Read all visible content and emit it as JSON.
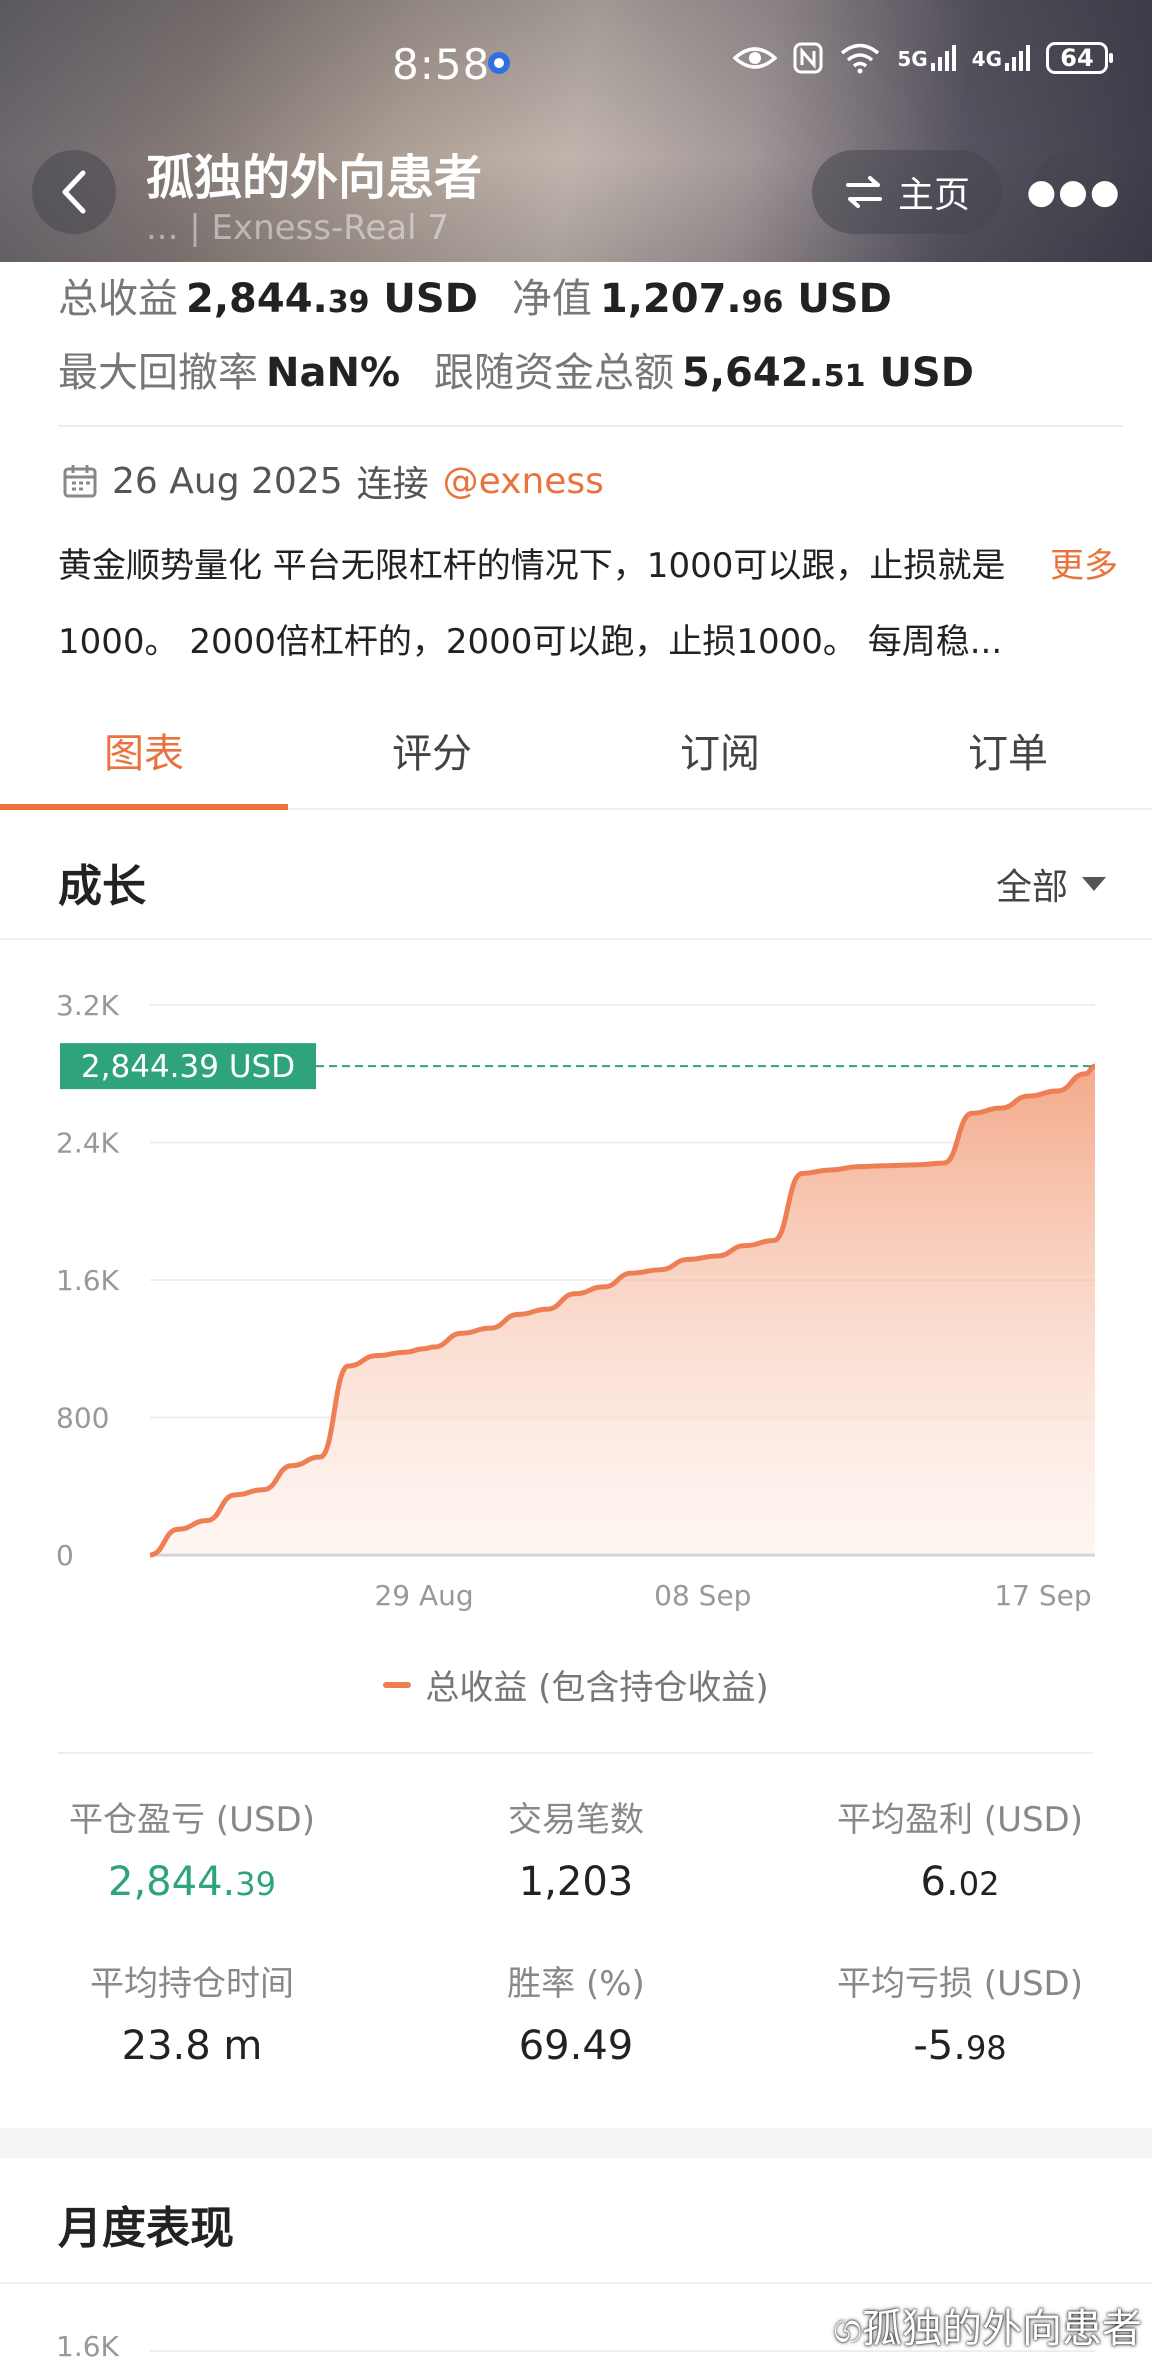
{
  "status_bar": {
    "time": "8:58",
    "network_1": "5G",
    "network_2": "4G",
    "battery": "64"
  },
  "header": {
    "title": "孤独的外向患者",
    "subtitle": "... | Exness-Real 7",
    "home_label": "主页"
  },
  "summary": {
    "total_profit_label": "总收益",
    "total_profit_int": "2,844.",
    "total_profit_dec": "39",
    "total_profit_unit": "USD",
    "equity_label": "净值",
    "equity_int": "1,207.",
    "equity_dec": "96",
    "equity_unit": "USD",
    "max_drawdown_label": "最大回撤率",
    "max_drawdown_value": "NaN%",
    "follow_funds_label": "跟随资金总额",
    "follow_funds_int": "5,642.",
    "follow_funds_dec": "51",
    "follow_funds_unit": "USD"
  },
  "meta": {
    "date": "26 Aug 2025",
    "connect_label": "连接",
    "broker_handle": "@exness"
  },
  "description": {
    "text": "黄金顺势量化 平台无限杠杆的情况下，1000可以跟，止损就是1000。 2000倍杠杆的，2000可以跑，止损1000。 每周稳...",
    "more_label": "更多"
  },
  "tabs": [
    {
      "label": "图表"
    },
    {
      "label": "评分"
    },
    {
      "label": "订阅"
    },
    {
      "label": "订单"
    }
  ],
  "growth": {
    "title": "成长",
    "range": "全部"
  },
  "chart_data": {
    "type": "area",
    "y_ticks": [
      "3.2K",
      "2.4K",
      "1.6K",
      "800",
      "0"
    ],
    "ylim": [
      0,
      3200
    ],
    "x_ticks": [
      "29 Aug",
      "08 Sep",
      "17 Sep"
    ],
    "current_label": "2,844.39 USD",
    "current_value": 2844.39,
    "legend": "总收益 (包含持仓收益)",
    "line_color": "#ee7f55",
    "marker_color": "#2fa37e",
    "x_index": [
      0,
      3,
      6,
      9,
      12,
      15,
      18,
      21,
      24,
      27,
      29,
      30,
      33,
      36,
      39,
      42,
      45,
      48,
      51,
      54,
      57,
      60,
      63,
      66,
      69,
      72,
      75,
      78,
      81,
      84,
      87,
      90,
      93,
      96,
      99,
      100
    ],
    "series": [
      {
        "values": [
          0,
          150,
          200,
          350,
          380,
          520,
          570,
          1100,
          1160,
          1180,
          1200,
          1210,
          1290,
          1320,
          1400,
          1430,
          1520,
          1560,
          1640,
          1660,
          1720,
          1740,
          1800,
          1830,
          2220,
          2240,
          2260,
          2265,
          2270,
          2280,
          2570,
          2600,
          2670,
          2700,
          2800,
          2844.39
        ]
      }
    ]
  },
  "stats": [
    {
      "label": "平仓盈亏 (USD)",
      "int": "2,844.",
      "dec": "39",
      "green": true
    },
    {
      "label": "交易笔数",
      "int": "1,203",
      "dec": "",
      "green": false
    },
    {
      "label": "平均盈利 (USD)",
      "int": "6.",
      "dec": "02",
      "green": false
    },
    {
      "label": "平均持仓时间",
      "int": "23.8 m",
      "dec": "",
      "green": false
    },
    {
      "label": "胜率 (%)",
      "int": "69.49",
      "dec": "",
      "green": false
    },
    {
      "label": "平均亏损 (USD)",
      "int": "-5.",
      "dec": "98",
      "green": false
    }
  ],
  "monthly": {
    "title": "月度表现",
    "first_tick": "1.6K"
  },
  "watermark": "孤独的外向患者"
}
